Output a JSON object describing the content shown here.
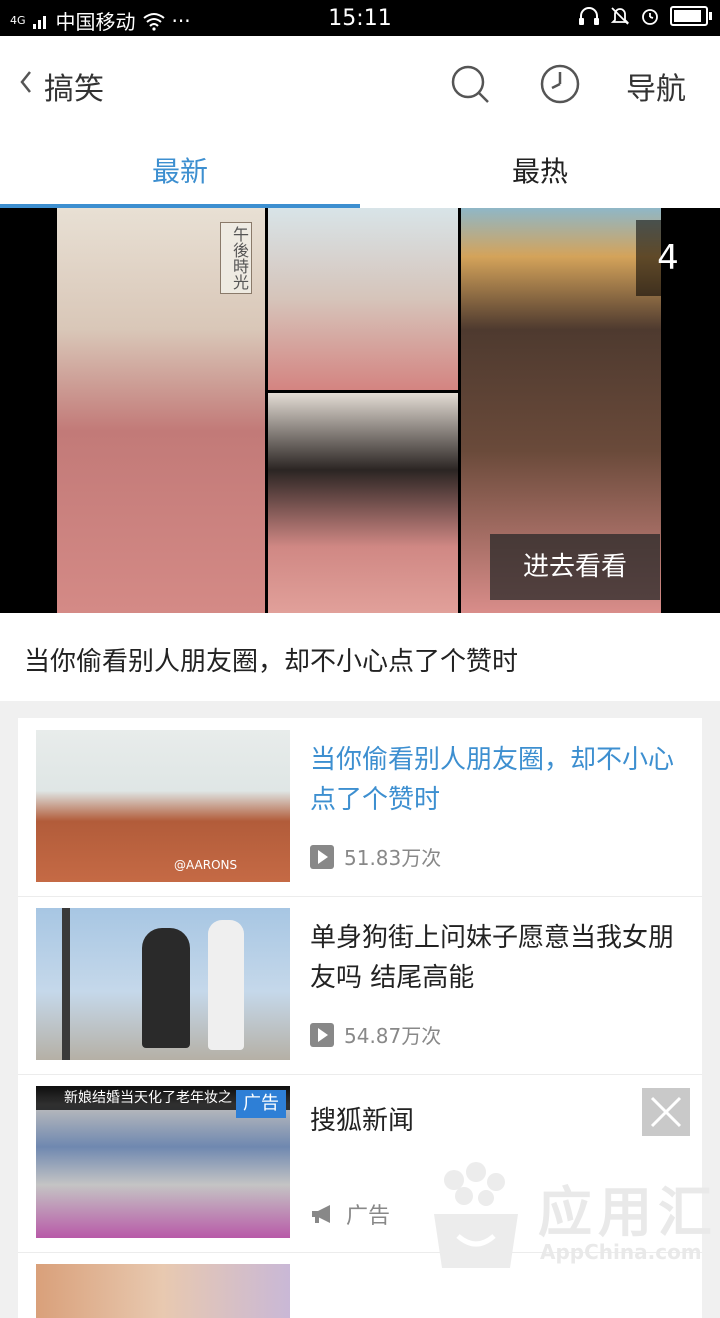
{
  "status_bar": {
    "network": "4G",
    "carrier": "中国移动",
    "more": "···",
    "time": "15:11"
  },
  "header": {
    "title": "搞笑",
    "nav_label": "导航"
  },
  "tabs": [
    {
      "label": "最新",
      "active": true
    },
    {
      "label": "最热",
      "active": false
    }
  ],
  "banner": {
    "overlay_text": "午後時光",
    "counter": "4",
    "enter_label": "进去看看",
    "headline": "当你偷看别人朋友圈，却不小心点了个赞时"
  },
  "list": [
    {
      "title": "当你偷看别人朋友圈，却不小心点了个赞时",
      "views": "51.83万次",
      "highlighted": true,
      "thumb_caption": "@AARONS"
    },
    {
      "title": "单身狗街上问妹子愿意当我女朋友吗 结尾高能",
      "views": "54.87万次",
      "highlighted": false
    }
  ],
  "ad": {
    "thumb_caption": "新娘结婚当天化了老年妆之",
    "badge": "广告",
    "source": "搜狐新闻",
    "label": "广告"
  },
  "watermark": {
    "brand": "应用汇",
    "sub": "AppChina.com"
  },
  "colors": {
    "accent": "#3d8fd0",
    "ad_badge": "#2e7fd6"
  }
}
